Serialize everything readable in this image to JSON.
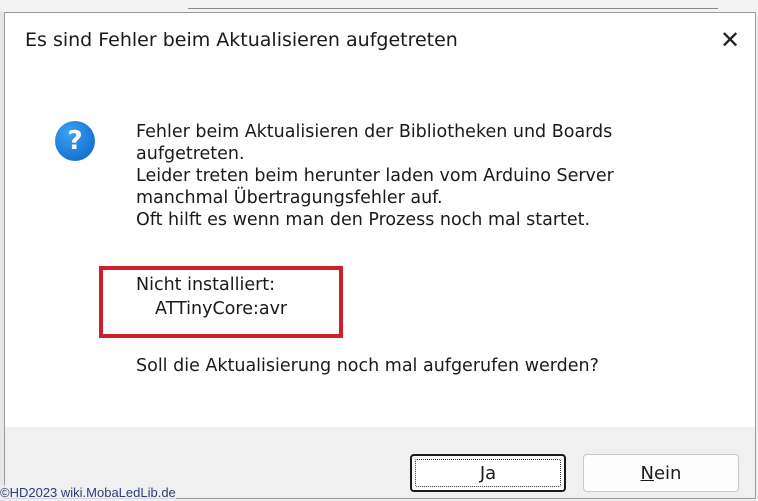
{
  "dialog": {
    "title": "Es sind Fehler beim Aktualisieren aufgetreten",
    "close_icon": "close-icon",
    "icon": "question-icon",
    "icon_glyph": "?",
    "message": "Fehler beim Aktualisieren der Bibliotheken und Boards\naufgetreten.\nLeider treten beim herunter laden vom Arduino Server\nmanchmal Übertragungsfehler auf.\nOft hilft es wenn man den Prozess noch mal startet.",
    "not_installed_label": "Nicht installiert:",
    "not_installed_value": "ATTinyCore:avr",
    "question": "Soll die Aktualisierung noch mal aufgerufen werden?",
    "buttons": {
      "yes_mnemonic": "J",
      "yes_rest": "a",
      "no_mnemonic": "N",
      "no_rest": "ein"
    }
  },
  "watermark": "©HD2023 wiki.MobaLedLib.de",
  "colors": {
    "highlight_border": "#d01f2c",
    "icon_blue": "#1976d2",
    "footer_bg": "#f0f0f0"
  }
}
